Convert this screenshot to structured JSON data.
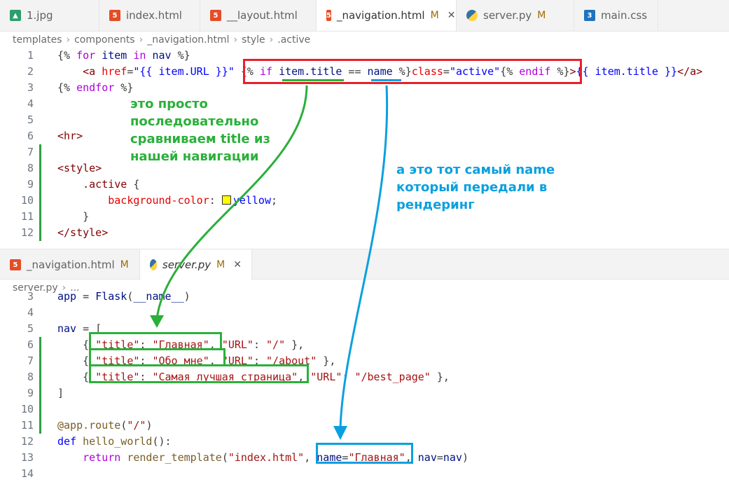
{
  "top_tabs": [
    {
      "icon": "img",
      "label": "1.jpg",
      "mod": "",
      "active": false
    },
    {
      "icon": "html",
      "label": "index.html",
      "mod": "",
      "active": false
    },
    {
      "icon": "html",
      "label": "__layout.html",
      "mod": "",
      "active": false
    },
    {
      "icon": "html",
      "label": "_navigation.html",
      "mod": "M",
      "active": true
    },
    {
      "icon": "py",
      "label": "server.py",
      "mod": "M",
      "active": false
    },
    {
      "icon": "css",
      "label": "main.css",
      "mod": "",
      "active": false
    }
  ],
  "top_breadcrumb": [
    "templates",
    "components",
    "_navigation.html",
    "style",
    ".active"
  ],
  "top_code": [
    {
      "n": "1",
      "html": "<span class='punct'>{% </span><span class='kw'>for</span><span class='var'> item </span><span class='kw'>in</span><span class='var'> nav </span><span class='punct'>%}</span>"
    },
    {
      "n": "2",
      "html": "<span class='ind'>    </span><span class='tag'>&lt;a</span> <span class='attr'>href</span>=<span class='blue'>\"{{ item.URL }}\"</span> <span class='punct'>{% </span><span class='kw'>if</span> <span class='var'>item.title</span> == <span class='var'>name</span> %}<span class='attr'>class</span>=<span class='blue'>\"active\"</span>{% <span class='kw'>endif</span> %}<span class='tag'>&gt;</span><span class='blue'>{{ item.title }}</span><span class='tag'>&lt;/a&gt;</span>"
    },
    {
      "n": "3",
      "html": "<span class='punct'>{% </span><span class='kw'>endfor</span><span class='punct'> %}</span>"
    },
    {
      "n": "4",
      "html": ""
    },
    {
      "n": "5",
      "html": ""
    },
    {
      "n": "6",
      "html": "<span class='tag'>&lt;hr&gt;</span>"
    },
    {
      "n": "7",
      "html": ""
    },
    {
      "n": "8",
      "html": "<span class='tag'>&lt;style&gt;</span>"
    },
    {
      "n": "9",
      "html": "<span class='ind'>    </span><span class='sel'>.active</span> {"
    },
    {
      "n": "10",
      "html": "<span class='ind'>        </span><span class='prop'>background-color</span>: <span class='swatch'></span><span class='blue'>yellow</span>;"
    },
    {
      "n": "11",
      "html": "<span class='ind'>    </span>}"
    },
    {
      "n": "12",
      "html": "<span class='tag'>&lt;/style&gt;</span>"
    }
  ],
  "bottom_tabs": [
    {
      "icon": "html",
      "label": "_navigation.html",
      "mod": "M",
      "active": false,
      "italic": false
    },
    {
      "icon": "py",
      "label": "server.py",
      "mod": "M",
      "active": true,
      "italic": true
    }
  ],
  "bottom_breadcrumb": [
    "server.py",
    "..."
  ],
  "bottom_code": [
    {
      "n": "3",
      "html": "<span class='var'>app</span> = <span class='var'>Flask</span>(<span class='var'>__name__</span>)"
    },
    {
      "n": "4",
      "html": ""
    },
    {
      "n": "5",
      "html": "<span class='var'>nav</span> = ["
    },
    {
      "n": "6",
      "html": "<span class='ind'>    </span>{ <span class='str'>\"title\"</span>: <span class='str'>\"Главная\"</span>, <span class='str'>\"URL\"</span>: <span class='str'>\"/\"</span> },"
    },
    {
      "n": "7",
      "html": "<span class='ind'>    </span>{ <span class='str'>\"title\"</span>: <span class='str'>\"Обо мне\"</span>, <span class='str'>\"URL\"</span>: <span class='str'>\"/about\"</span> },"
    },
    {
      "n": "8",
      "html": "<span class='ind'>    </span>{ <span class='str'>\"title\"</span>: <span class='str'>\"Самая лучшая страница\"</span>, <span class='str'>\"URL\"</span>: <span class='str'>\"/best_page\"</span> },"
    },
    {
      "n": "9",
      "html": "]"
    },
    {
      "n": "10",
      "html": ""
    },
    {
      "n": "11",
      "html": "<span class='fn'>@app.route</span>(<span class='str'>\"/\"</span>)"
    },
    {
      "n": "12",
      "html": "<span class='blue'>def</span> <span class='fn'>hello_world</span>():"
    },
    {
      "n": "13",
      "html": "<span class='ind'>    </span><span class='kw'>return</span> <span class='fn'>render_template</span>(<span class='str'>\"index.html\"</span>, <span class='var'>name</span>=<span class='str'>\"Главная\"</span>, <span class='var'>nav</span>=<span class='var'>nav</span>)"
    },
    {
      "n": "14",
      "html": ""
    }
  ],
  "annotations": {
    "green": "это просто\nпоследовательно\nсравниваем title из\nнашей навигации",
    "blue": "а это тот самый name\nкоторый передали в\nрендеринг"
  },
  "colors": {
    "green": "#2ab03a",
    "blue": "#0aa0e0",
    "red": "#e8202a"
  }
}
